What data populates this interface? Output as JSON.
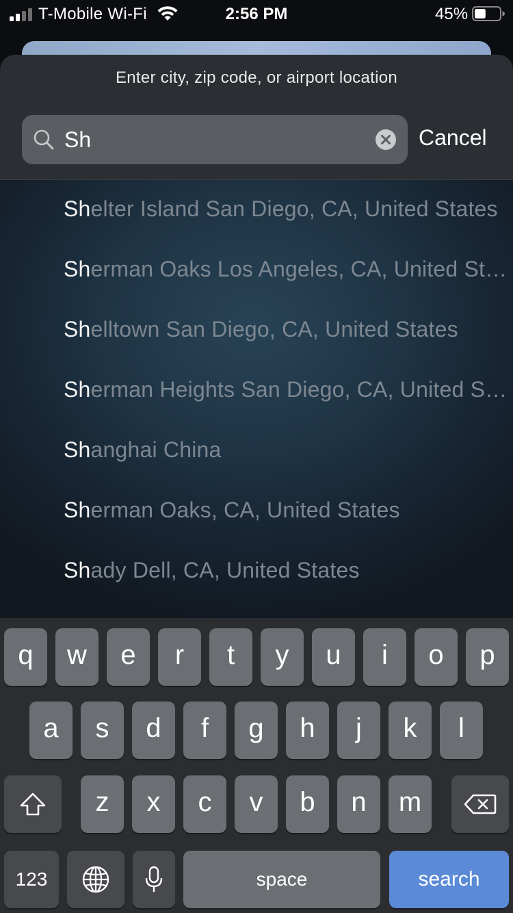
{
  "status_bar": {
    "carrier": "T-Mobile Wi-Fi",
    "time": "2:56 PM",
    "battery_percent": "45%",
    "battery_level": 0.45
  },
  "sheet": {
    "prompt": "Enter city, zip code, or airport location",
    "search": {
      "value": "Sh",
      "placeholder": ""
    },
    "cancel_label": "Cancel"
  },
  "results": [
    {
      "match": "Sh",
      "rest": "elter Island San Diego, CA, United States"
    },
    {
      "match": "Sh",
      "rest": "erman Oaks Los Angeles, CA, United States"
    },
    {
      "match": "Sh",
      "rest": "elltown San Diego, CA, United States"
    },
    {
      "match": "Sh",
      "rest": "erman Heights San Diego, CA, United States"
    },
    {
      "match": "Sh",
      "rest": "anghai China"
    },
    {
      "match": "Sh",
      "rest": "erman Oaks, CA, United States"
    },
    {
      "match": "Sh",
      "rest": "ady Dell, CA, United States"
    }
  ],
  "keyboard": {
    "row1": [
      "q",
      "w",
      "e",
      "r",
      "t",
      "y",
      "u",
      "i",
      "o",
      "p"
    ],
    "row2": [
      "a",
      "s",
      "d",
      "f",
      "g",
      "h",
      "j",
      "k",
      "l"
    ],
    "row3": [
      "z",
      "x",
      "c",
      "v",
      "b",
      "n",
      "m"
    ],
    "numbers_label": "123",
    "space_label": "space",
    "search_label": "search",
    "icons": {
      "shift": "shift-icon",
      "delete": "backspace-icon",
      "globe": "globe-icon",
      "mic": "microphone-icon"
    }
  },
  "colors": {
    "accent": "#5b8ad6",
    "highlight_text": "#f3f3f3",
    "dim_text": "#7d8791"
  }
}
